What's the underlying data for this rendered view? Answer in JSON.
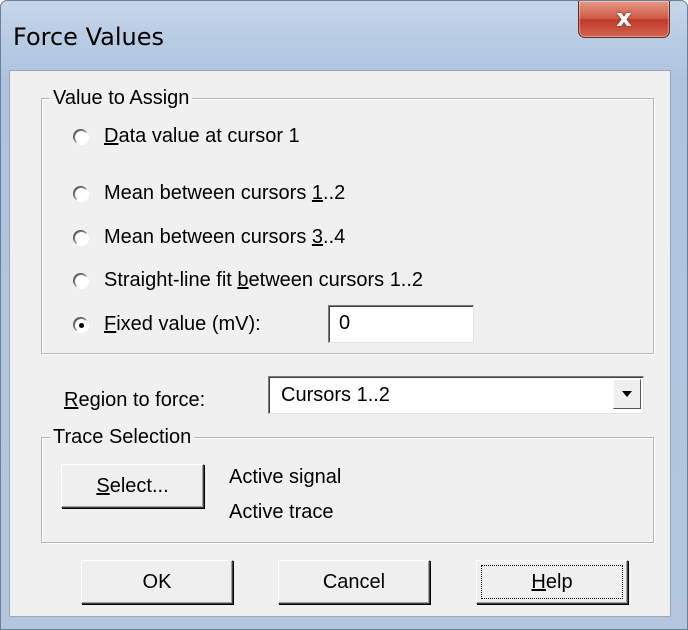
{
  "window": {
    "title": "Force Values",
    "close_glyph": "x"
  },
  "value_group": {
    "legend": "Value to Assign",
    "options": [
      {
        "pre": "",
        "accel": "D",
        "post": "ata value at cursor 1",
        "checked": false
      },
      {
        "pre": "Mean between cursors ",
        "accel": "1",
        "post": "..2",
        "checked": false
      },
      {
        "pre": "Mean between cursors ",
        "accel": "3",
        "post": "..4",
        "checked": false
      },
      {
        "pre": "Straight-line fit ",
        "accel": "b",
        "post": "etween cursors 1..2",
        "checked": false
      },
      {
        "pre": "",
        "accel": "F",
        "post": "ixed value (mV):",
        "checked": true
      }
    ],
    "fixed_value": "0"
  },
  "region": {
    "label_accel": "R",
    "label_rest": "egion to force:",
    "selected": "Cursors 1..2"
  },
  "trace_group": {
    "legend": "Trace Selection",
    "select_accel": "S",
    "select_rest": "elect...",
    "active_signal": "Active signal",
    "active_trace": "Active trace"
  },
  "buttons": {
    "ok": "OK",
    "cancel": "Cancel",
    "help_accel": "H",
    "help_rest": "elp"
  }
}
